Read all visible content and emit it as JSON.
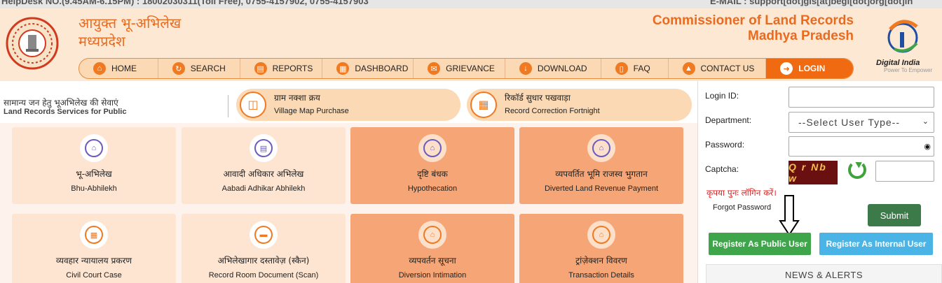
{
  "topbar": {
    "helpdesk": "HelpDesk NO.(9.45AM-6.15PM) : 18002030311(Toll Free), 0755-4157902, 0755-4157903",
    "email": "E-MAIL : support[dot]gis[at]begl[dot]org[dot]in"
  },
  "header": {
    "title_hi_line1": "आयुक्त भू-अभिलेख",
    "title_hi_line2": "मध्यप्रदेश",
    "title_en_line1": "Commissioner of Land Records",
    "title_en_line2": "Madhya Pradesh",
    "digital_india": "Digital India",
    "digital_india_tagline": "Power To Empower"
  },
  "nav": {
    "items": [
      {
        "label": "HOME",
        "icon": "home-icon"
      },
      {
        "label": "SEARCH",
        "icon": "refresh-search-icon"
      },
      {
        "label": "REPORTS",
        "icon": "report-icon"
      },
      {
        "label": "DASHBOARD",
        "icon": "grid-icon"
      },
      {
        "label": "GRIEVANCE",
        "icon": "chat-icon"
      },
      {
        "label": "DOWNLOAD",
        "icon": "download-icon"
      },
      {
        "label": "FAQ",
        "icon": "bookmark-icon"
      },
      {
        "label": "CONTACT US",
        "icon": "navigation-icon"
      },
      {
        "label": "LOGIN",
        "icon": "login-icon"
      }
    ]
  },
  "services_heading": {
    "hi": "सामान्य जन हेतु भूअभिलेख की सेवाएं",
    "en": "Land Records Services for Public"
  },
  "pills": [
    {
      "hi": "ग्राम नक्शा क्रय",
      "en": "Village Map Purchase",
      "icon": "map-icon"
    },
    {
      "hi": "रिकॉर्ड सुधार पखवाड़ा",
      "en": "Record Correction Fortnight",
      "icon": "calendar-icon"
    }
  ],
  "tiles": [
    {
      "hi": "भू-अभिलेख",
      "en": "Bhu-Abhilekh"
    },
    {
      "hi": "आवादी अधिकार अभिलेख",
      "en": "Aabadi Adhikar Abhilekh"
    },
    {
      "hi": "दृष्टि बंधक",
      "en": "Hypothecation"
    },
    {
      "hi": "व्यपवर्तित भूमि राजस्व भुगतान",
      "en": "Diverted Land Revenue Payment"
    },
    {
      "hi": "व्यवहार न्यायालय प्रकरण",
      "en": "Civil Court Case"
    },
    {
      "hi": "अभिलेखागार दस्तावेज़ (स्कैन)",
      "en": "Record Room Document (Scan)"
    },
    {
      "hi": "व्यपवर्तन सूचना",
      "en": "Diversion Intimation"
    },
    {
      "hi": "ट्रांज़ेक्शन विवरण",
      "en": "Transaction Details"
    }
  ],
  "login": {
    "login_id_label": "Login ID:",
    "login_id_value": "",
    "department_label": "Department:",
    "department_selected": "--Select User Type--",
    "password_label": "Password:",
    "password_value": "",
    "captcha_label": "Captcha:",
    "captcha_text": "Q r Nb w",
    "captcha_value": "",
    "retry_message": "कृपया पुनः लॉगिन करें।",
    "forgot_password": "Forgot Password",
    "submit": "Submit",
    "register_public": "Register As Public User",
    "register_internal": "Register As Internal User",
    "news_alerts": "NEWS & ALERTS"
  }
}
